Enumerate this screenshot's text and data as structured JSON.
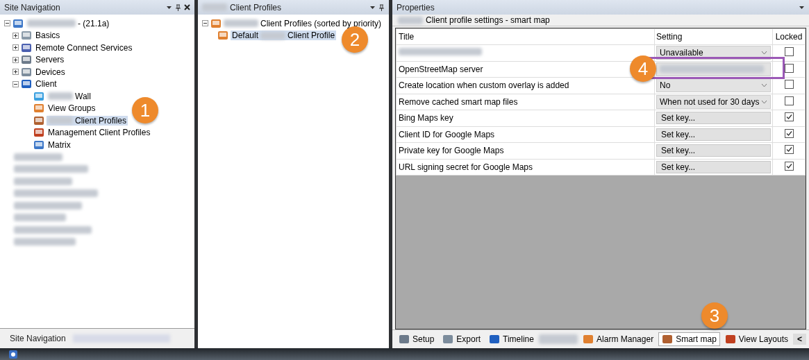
{
  "site_navigation": {
    "title": "Site Navigation",
    "tree": {
      "label": "- (21.1a)",
      "blurred_prefix": true,
      "expanded": true,
      "children": [
        {
          "label": "Basics",
          "expanded": false,
          "selected": false
        },
        {
          "label": "Remote Connect Services",
          "expanded": false,
          "selected": false
        },
        {
          "label": "Servers",
          "expanded": false,
          "selected": false
        },
        {
          "label": "Devices",
          "expanded": false,
          "selected": false
        },
        {
          "label": "Client",
          "expanded": true,
          "selected": false,
          "children": [
            {
              "label": "Wall",
              "blurred_prefix": true,
              "selected": false
            },
            {
              "label": "View Groups",
              "blurred_prefix": false,
              "selected": false
            },
            {
              "label": "Client Profiles",
              "blurred_prefix": true,
              "selected": true
            },
            {
              "label": "Management Client Profiles",
              "blurred_prefix": false,
              "selected": false
            },
            {
              "label": "Matrix",
              "blurred_prefix": false,
              "selected": false
            }
          ]
        }
      ]
    },
    "tabs": [
      {
        "label": "Site Navigation",
        "selected": true
      }
    ]
  },
  "client_profiles": {
    "title": "Client Profiles",
    "tree": {
      "label": "Client Profiles (sorted by priority)",
      "expanded": true,
      "children": [
        {
          "label": "Default",
          "label_after": "Client Profile",
          "selected": true
        }
      ]
    }
  },
  "properties": {
    "title": "Properties",
    "heading": "Client profile settings - smart map",
    "columns": [
      "Title",
      "Setting",
      "Locked"
    ],
    "rows": [
      {
        "kind": "dropdown",
        "setting": "Unavailable",
        "locked": false
      },
      {
        "kind": "text",
        "title": "OpenStreetMap server",
        "locked": false
      },
      {
        "kind": "dropdown",
        "title": "Create location when custom overlay is added",
        "setting": "No",
        "locked": false
      },
      {
        "kind": "dropdown",
        "title": "Remove cached smart map files",
        "setting": "When not used for 30 days",
        "locked": false
      },
      {
        "kind": "button",
        "title": "Bing Maps key",
        "setting": "Set key...",
        "locked": true
      },
      {
        "kind": "button",
        "title": "Client ID for Google Maps",
        "setting": "Set key...",
        "locked": true
      },
      {
        "kind": "button",
        "title": "Private key for Google Maps",
        "setting": "Set key...",
        "locked": true
      },
      {
        "kind": "button",
        "title": "URL signing secret for Google Maps",
        "setting": "Set key...",
        "locked": true
      }
    ],
    "tabs": [
      {
        "label": "Setup",
        "selected": false
      },
      {
        "label": "Export",
        "selected": false
      },
      {
        "label": "Timeline",
        "selected": false
      },
      {
        "kind": "blurred",
        "selected": false
      },
      {
        "label": "Alarm Manager",
        "selected": false
      },
      {
        "label": "Smart map",
        "selected": true
      },
      {
        "label": "View Layouts",
        "selected": false
      }
    ],
    "scroll_button": "<"
  },
  "callouts": [
    "1",
    "2",
    "3",
    "4"
  ]
}
